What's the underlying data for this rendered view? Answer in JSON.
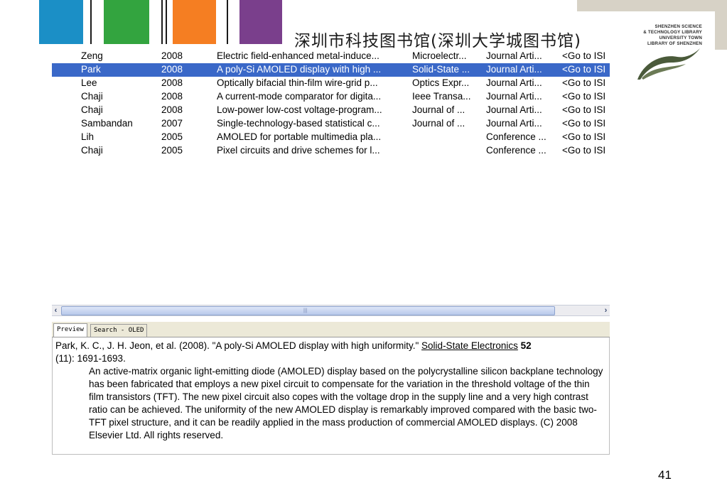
{
  "header": {
    "library_title": "深圳市科技图书馆(深圳大学城图书馆)",
    "logo_lines": [
      "SHENZHEN SCIENCE",
      "& TECHNOLOGY LIBRARY",
      "UNIVERSITY TOWN",
      "LIBRARY OF SHENZHEN"
    ],
    "block_colors": [
      "#1b8fc6",
      "#33a43f",
      "#f57e22",
      "#7a3f8c"
    ]
  },
  "references": [
    {
      "author": "Zeng",
      "year": "2008",
      "title": "Electric field-enhanced metal-induce...",
      "journal": "Microelectr...",
      "type": "Journal Arti...",
      "url": "<Go to ISI",
      "selected": false
    },
    {
      "author": "Park",
      "year": "2008",
      "title": "A poly-Si AMOLED display with high ...",
      "journal": "Solid-State ...",
      "type": "Journal Arti...",
      "url": "<Go to ISI",
      "selected": true
    },
    {
      "author": "Lee",
      "year": "2008",
      "title": "Optically bifacial thin-film wire-grid p...",
      "journal": "Optics Expr...",
      "type": "Journal Arti...",
      "url": "<Go to ISI",
      "selected": false
    },
    {
      "author": "Chaji",
      "year": "2008",
      "title": "A current-mode comparator for digita...",
      "journal": "Ieee Transa...",
      "type": "Journal Arti...",
      "url": "<Go to ISI",
      "selected": false
    },
    {
      "author": "Chaji",
      "year": "2008",
      "title": "Low-power low-cost voltage-program...",
      "journal": "Journal of ...",
      "type": "Journal Arti...",
      "url": "<Go to ISI",
      "selected": false
    },
    {
      "author": "Sambandan",
      "year": "2007",
      "title": "Single-technology-based statistical c...",
      "journal": "Journal of ...",
      "type": "Journal Arti...",
      "url": "<Go to ISI",
      "selected": false
    },
    {
      "author": "Lih",
      "year": "2005",
      "title": "AMOLED for portable multimedia pla...",
      "journal": "",
      "type": "Conference ...",
      "url": "<Go to ISI",
      "selected": false
    },
    {
      "author": "Chaji",
      "year": "2005",
      "title": "Pixel circuits and drive schemes for l...",
      "journal": "",
      "type": "Conference ...",
      "url": "<Go to ISI",
      "selected": false
    }
  ],
  "scrollbar": {
    "left_arrow": "‹",
    "right_arrow": "›",
    "grip": "|||"
  },
  "tabs": [
    {
      "label": "Preview",
      "active": true
    },
    {
      "label": "Search - OLED",
      "active": false
    }
  ],
  "preview": {
    "citation_prefix": "Park, K. C., J. H. Jeon, et al. (2008). \"A poly-Si AMOLED display with high uniformity.\" ",
    "citation_journal": "Solid-State Electronics",
    "citation_volume": "52",
    "citation_suffix": "(11): 1691-1693.",
    "abstract": "An active-matrix organic light-emitting diode (AMOLED) display based on the polycrystalline silicon backplane technology has been fabricated that employs a new pixel circuit to compensate for the variation in the threshold voltage of the thin film transistors (TFT). The new pixel circuit also copes with the voltage drop in the supply line and a very high contrast ratio can be achieved. The uniformity of the new AMOLED display is remarkably improved compared with the basic two-TFT pixel structure, and it can be readily applied in the mass production of commercial AMOLED displays. (C) 2008 Elsevier Ltd. All rights reserved."
  },
  "page_number": "41"
}
